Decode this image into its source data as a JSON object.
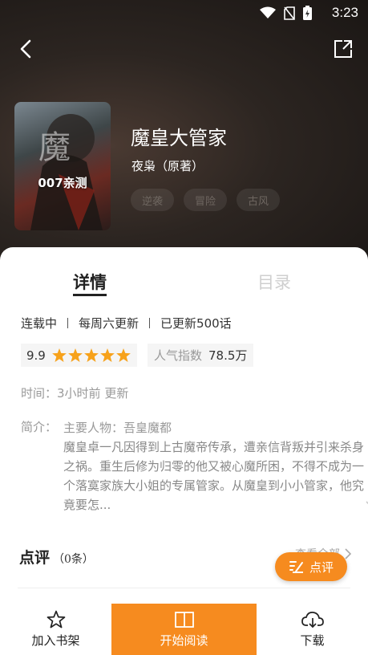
{
  "status_bar": {
    "time": "3:23"
  },
  "book": {
    "cover_label": "007亲测",
    "title": "魔皇大管家",
    "author": "夜枭（原著）",
    "tags": [
      "逆袭",
      "冒险",
      "古风"
    ]
  },
  "tabs": {
    "detail": "详情",
    "catalog": "目录"
  },
  "meta": {
    "status": "连载中",
    "schedule": "每周六更新",
    "chapters": "已更新500话"
  },
  "rating": {
    "score": "9.9",
    "stars": 5
  },
  "popularity": {
    "label": "人气指数",
    "value": "78.5万"
  },
  "update_time": {
    "label": "时间：",
    "value": "3小时前 更新"
  },
  "intro": {
    "label": "简介：",
    "first_line": "主要人物：吾皇魔都",
    "text": "魔皇卓一凡因得到上古魔帝传承，遭亲信背叛并引来杀身之祸。重生后修为归零的他又被心魔所困，不得不成为一个落寞家族大小姐的专属管家。从魔皇到小小管家，他究竟要怎..."
  },
  "reviews": {
    "title": "点评",
    "count": "（0条）",
    "view_all": "查看全部",
    "fab_label": "点评"
  },
  "bottom_bar": {
    "shelf": "加入书架",
    "read": "开始阅读",
    "download": "下载"
  },
  "colors": {
    "accent": "#f68b1f",
    "star": "#f7a21b"
  }
}
